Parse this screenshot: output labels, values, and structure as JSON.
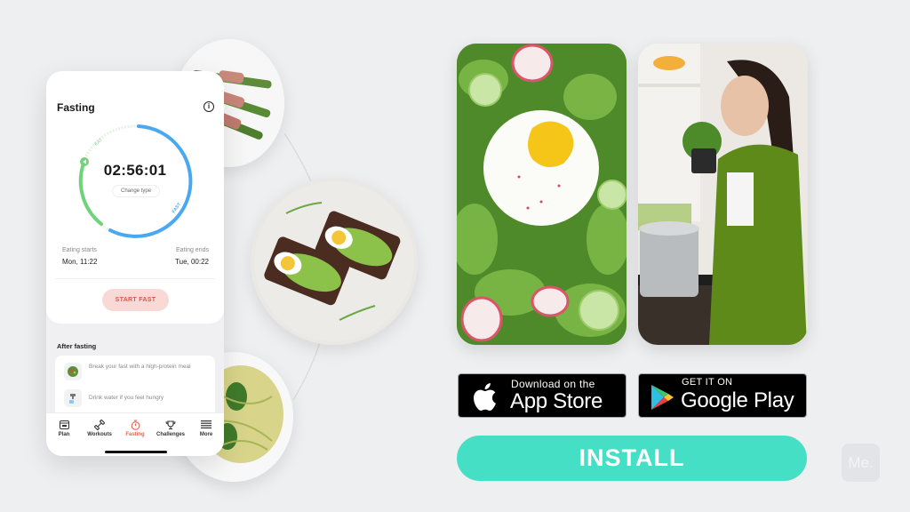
{
  "phone": {
    "title": "Fasting",
    "timer": "02:56:01",
    "change_type_label": "Change type",
    "ring": {
      "eat_label": "EAT",
      "fast_label": "FAST",
      "elapsed_fraction": 0.12,
      "eat_color": "#6fd37c",
      "fast_color": "#4aa8f0"
    },
    "eating_starts_label": "Eating starts",
    "eating_starts_value": "Mon, 11:22",
    "eating_ends_label": "Eating ends",
    "eating_ends_value": "Tue, 00:22",
    "start_button": "START FAST",
    "after_fasting_title": "After fasting",
    "tips": [
      {
        "icon": "salad-bowl-icon",
        "text": "Break your fast with a high-protein meal"
      },
      {
        "icon": "water-tap-icon",
        "text": "Drink water if you feel hungry"
      }
    ],
    "tabs": [
      {
        "label": "Plan",
        "icon": "calendar-icon",
        "active": false
      },
      {
        "label": "Workouts",
        "icon": "dumbbell-icon",
        "active": false
      },
      {
        "label": "Fasting",
        "icon": "stopwatch-icon",
        "active": true
      },
      {
        "label": "Challenges",
        "icon": "trophy-icon",
        "active": false
      },
      {
        "label": "More",
        "icon": "menu-icon",
        "active": false
      }
    ],
    "accent_color": "#e8634f"
  },
  "images": {
    "plate_1": "asparagus wrapped in bacon",
    "plate_2": "avocado egg toast",
    "plate_3": "zucchini pasta with basil",
    "photo_1": "poached egg arugula salad",
    "photo_2": "woman smelling basil in kitchen"
  },
  "badges": {
    "apple_small": "Download on the",
    "apple_big": "App Store",
    "google_small": "GET IT ON",
    "google_big": "Google Play"
  },
  "install_button": "INSTALL",
  "install_color": "#45dfc6",
  "brand_logo": "Me."
}
